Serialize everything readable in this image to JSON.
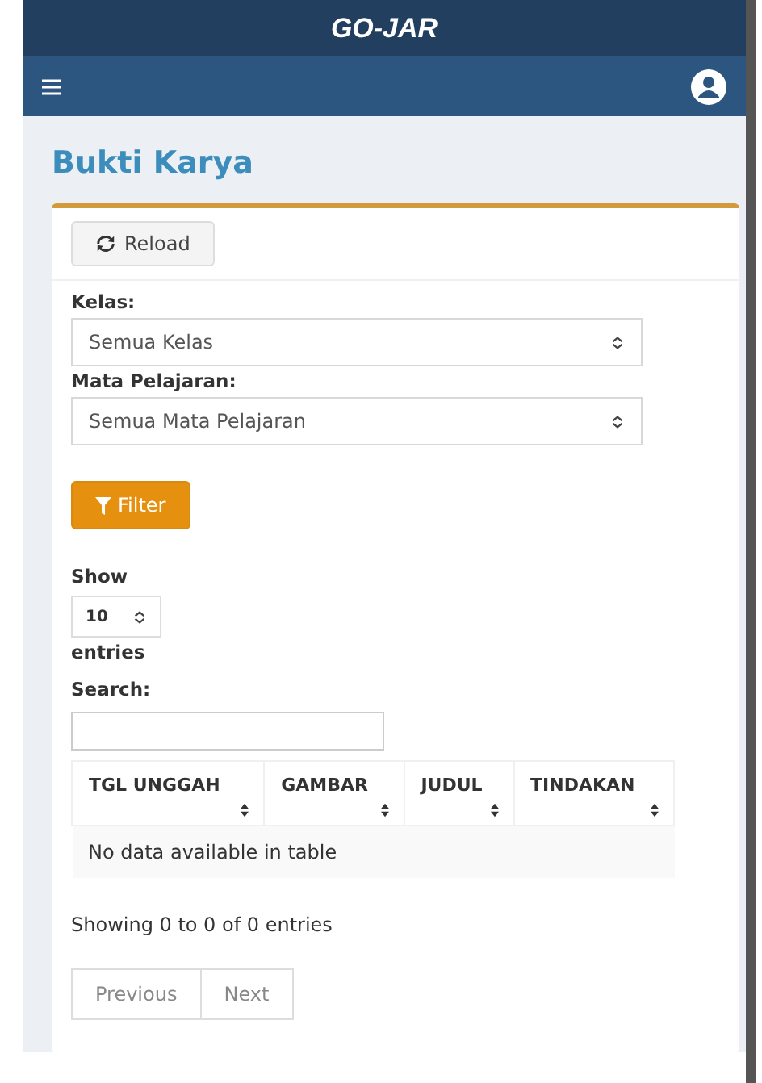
{
  "app_title": "GO-JAR",
  "page_title": "Bukti Karya",
  "reload_button": "Reload",
  "filters": [
    {
      "label": "Kelas:",
      "value": "Semua Kelas"
    },
    {
      "label": "Mata Pelajaran:",
      "value": "Semua Mata Pelajaran"
    }
  ],
  "filter_button": "Filter",
  "length": {
    "show": "Show",
    "value": "10",
    "entries": "entries"
  },
  "search": {
    "label": "Search:"
  },
  "table": {
    "columns": [
      "TGL UNGGAH",
      "GAMBAR",
      "JUDUL",
      "TINDAKAN"
    ],
    "empty": "No data available in table"
  },
  "info": "Showing 0 to 0 of 0 entries",
  "pagination": [
    {
      "label": "Previous",
      "disabled": true
    },
    {
      "label": "Next",
      "disabled": true
    }
  ]
}
